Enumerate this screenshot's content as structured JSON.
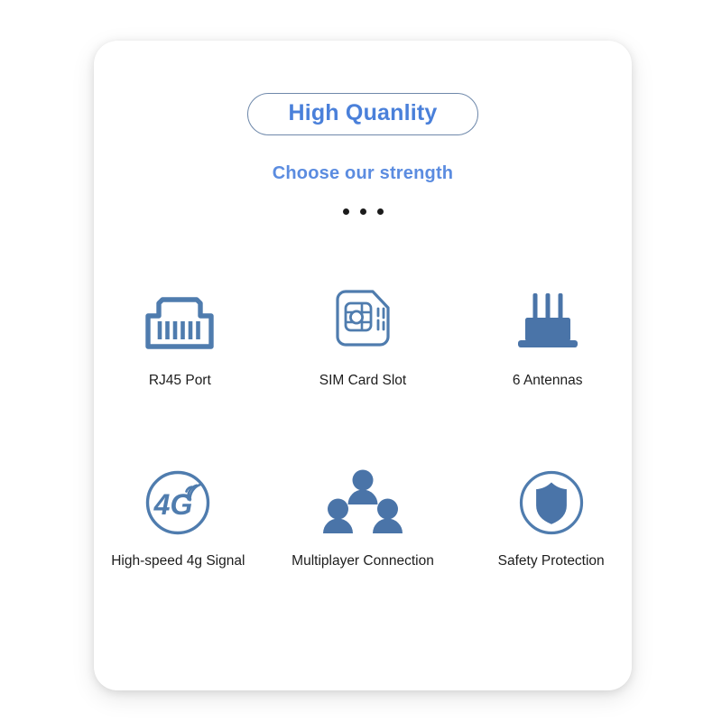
{
  "card": {
    "title": "High Quanlity",
    "subtitle": "Choose our strength",
    "dots_count": 3,
    "colors": {
      "title_text": "#4a80da",
      "title_border": "#6f89ab",
      "subtitle_text": "#5b8ce0",
      "icon_stroke": "#4f7cae",
      "icon_fill": "#4a74a8",
      "caption_text": "#1d1d1d",
      "card_background": "#ffffff",
      "page_background": "#ffffff",
      "dot": "#1b1b1b"
    }
  },
  "features": [
    {
      "icon": "rj45-port-icon",
      "label": "RJ45 Port"
    },
    {
      "icon": "sim-card-icon",
      "label": "SIM Card Slot"
    },
    {
      "icon": "router-antennas-icon",
      "label": "6 Antennas"
    },
    {
      "icon": "4g-signal-icon",
      "label": "High-speed 4g Signal"
    },
    {
      "icon": "multiplayer-users-icon",
      "label": "Multiplayer Connection"
    },
    {
      "icon": "shield-protection-icon",
      "label": "Safety Protection"
    }
  ]
}
